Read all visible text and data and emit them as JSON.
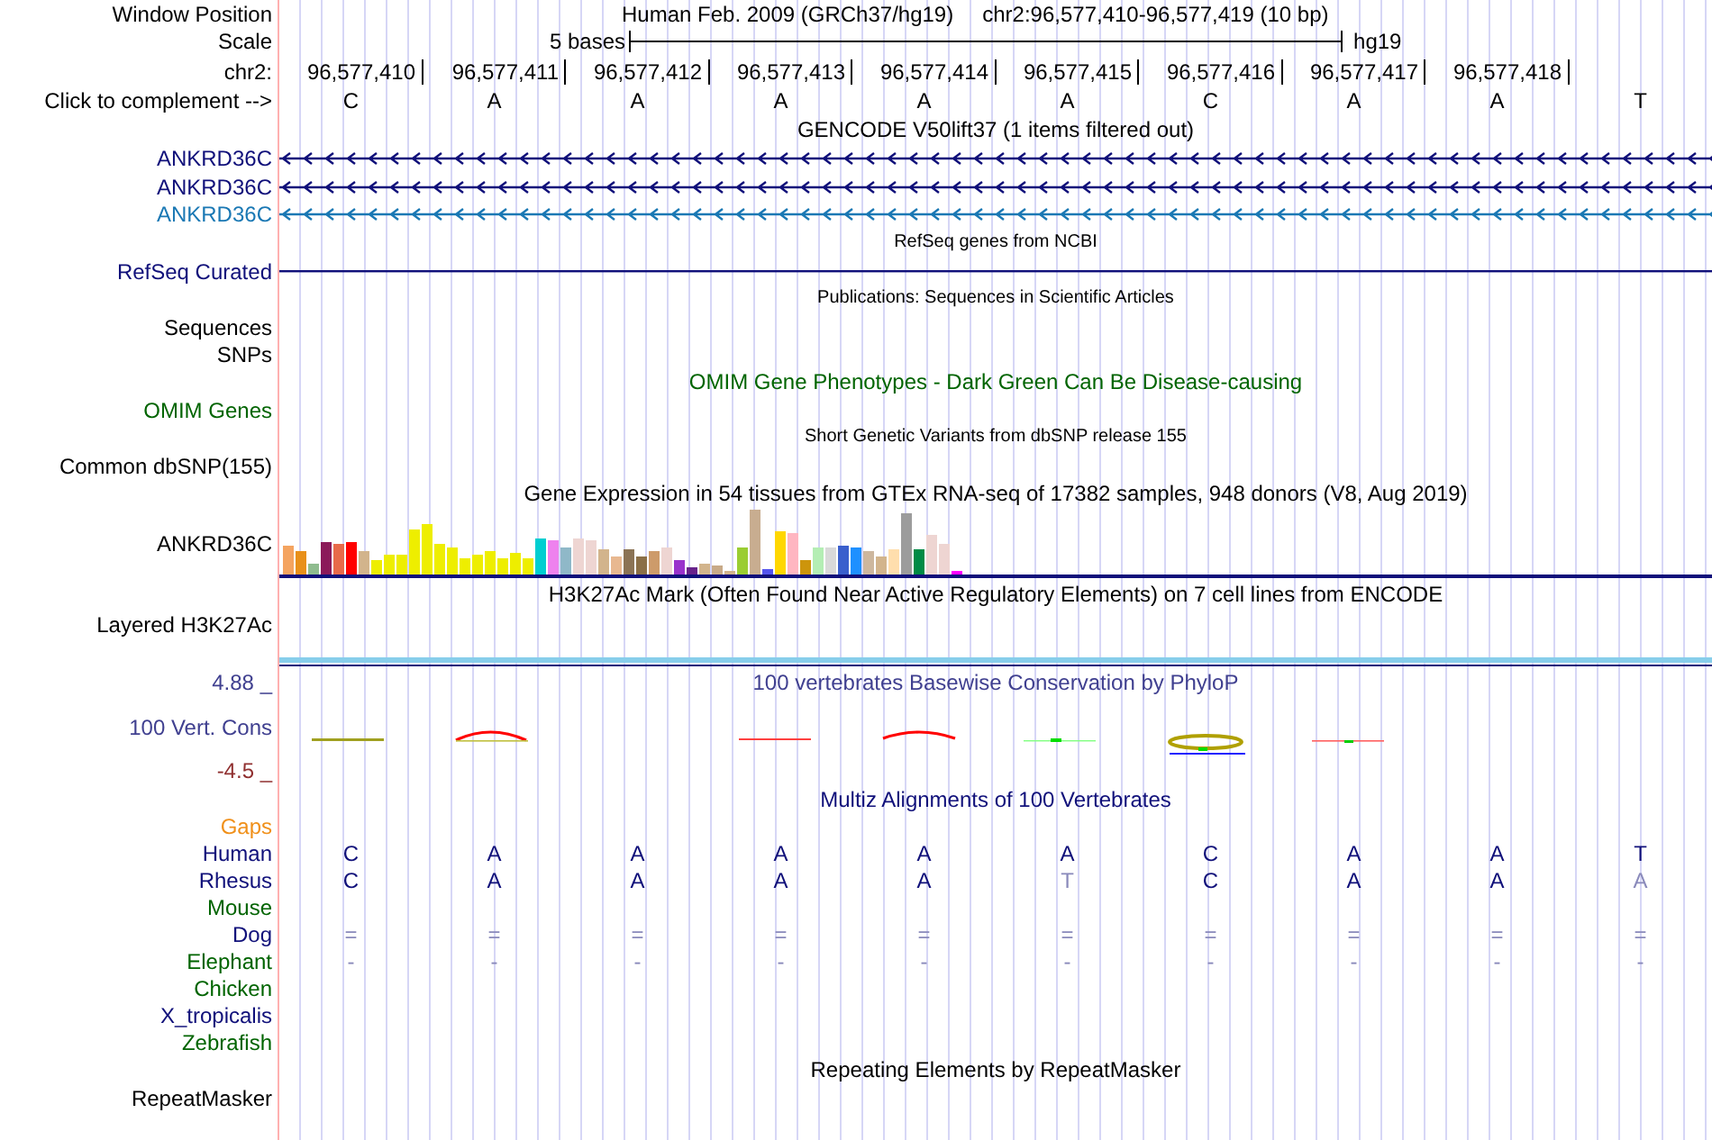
{
  "header": {
    "label": "Window Position",
    "assembly": "Human Feb. 2009 (GRCh37/hg19)",
    "position": "chr2:96,577,410-96,577,419 (10 bp)"
  },
  "scale": {
    "label": "Scale",
    "span": "5 bases",
    "assembly": "hg19"
  },
  "ruler": {
    "label": "chr2:",
    "positions": [
      "96,577,410",
      "96,577,411",
      "96,577,412",
      "96,577,413",
      "96,577,414",
      "96,577,415",
      "96,577,416",
      "96,577,417",
      "96,577,418"
    ]
  },
  "sequence": {
    "label": "Click to complement -->",
    "bases": [
      "C",
      "A",
      "A",
      "A",
      "A",
      "A",
      "C",
      "A",
      "A",
      "T"
    ]
  },
  "tracks": [
    {
      "kind": "genes",
      "title": "GENCODE V50lift37 (1 items filtered out)",
      "items": [
        {
          "name": "ANKRD36C",
          "color": "#10107a"
        },
        {
          "name": "ANKRD36C",
          "color": "#10107a"
        },
        {
          "name": "ANKRD36C",
          "color": "#1a78b4"
        }
      ]
    },
    {
      "kind": "line",
      "title": "RefSeq genes from NCBI",
      "label": "RefSeq Curated",
      "color": "#10107a"
    },
    {
      "kind": "labels",
      "title": "Publications: Sequences in Scientific Articles",
      "labels": [
        "Sequences",
        "SNPs"
      ],
      "color": "#000000"
    },
    {
      "kind": "labels",
      "title": "OMIM Gene Phenotypes - Dark Green Can Be Disease-causing",
      "labels": [
        "OMIM Genes"
      ],
      "color": "#006400"
    },
    {
      "kind": "labels",
      "title": "Short Genetic Variants from dbSNP release 155",
      "labels": [
        "Common dbSNP(155)"
      ],
      "color": "#000000"
    },
    {
      "kind": "expression",
      "title": "Gene Expression in 54 tissues from GTEx RNA-seq of 17382 samples, 948 donors (V8, Aug 2019)",
      "label": "ANKRD36C"
    },
    {
      "kind": "signal",
      "title": "H3K27Ac Mark (Often Found Near Active Regulatory Elements) on 7 cell lines from ENCODE",
      "label": "Layered H3K27Ac"
    },
    {
      "kind": "conservation",
      "title": "100 vertebrates Basewise Conservation by PhyloP",
      "label": "100 Vert. Cons",
      "max": "4.88 _",
      "min": "-4.5 _"
    },
    {
      "kind": "multiz",
      "title": "Multiz Alignments of 100 Vertebrates",
      "species": [
        {
          "name": "Gaps",
          "color": "#f0901a"
        },
        {
          "name": "Human",
          "color": "#10107a",
          "bases": [
            "C",
            "A",
            "A",
            "A",
            "A",
            "A",
            "C",
            "A",
            "A",
            "T"
          ]
        },
        {
          "name": "Rhesus",
          "color": "#10107a",
          "bases": [
            "C",
            "A",
            "A",
            "A",
            "A",
            "T",
            "C",
            "A",
            "A",
            "A"
          ]
        },
        {
          "name": "Mouse",
          "color": "#006400"
        },
        {
          "name": "Dog",
          "color": "#10107a",
          "bases": [
            "=",
            "=",
            "=",
            "=",
            "=",
            "=",
            "=",
            "=",
            "=",
            "="
          ]
        },
        {
          "name": "Elephant",
          "color": "#006400",
          "bases": [
            "-",
            "-",
            "-",
            "-",
            "-",
            "-",
            "-",
            "-",
            "-",
            "-"
          ]
        },
        {
          "name": "Chicken",
          "color": "#006400"
        },
        {
          "name": "X_tropicalis",
          "color": "#10107a"
        },
        {
          "name": "Zebrafish",
          "color": "#006400"
        }
      ]
    },
    {
      "kind": "labels",
      "title": "Repeating Elements by RepeatMasker",
      "labels": [
        "RepeatMasker"
      ],
      "color": "#000000"
    }
  ]
}
